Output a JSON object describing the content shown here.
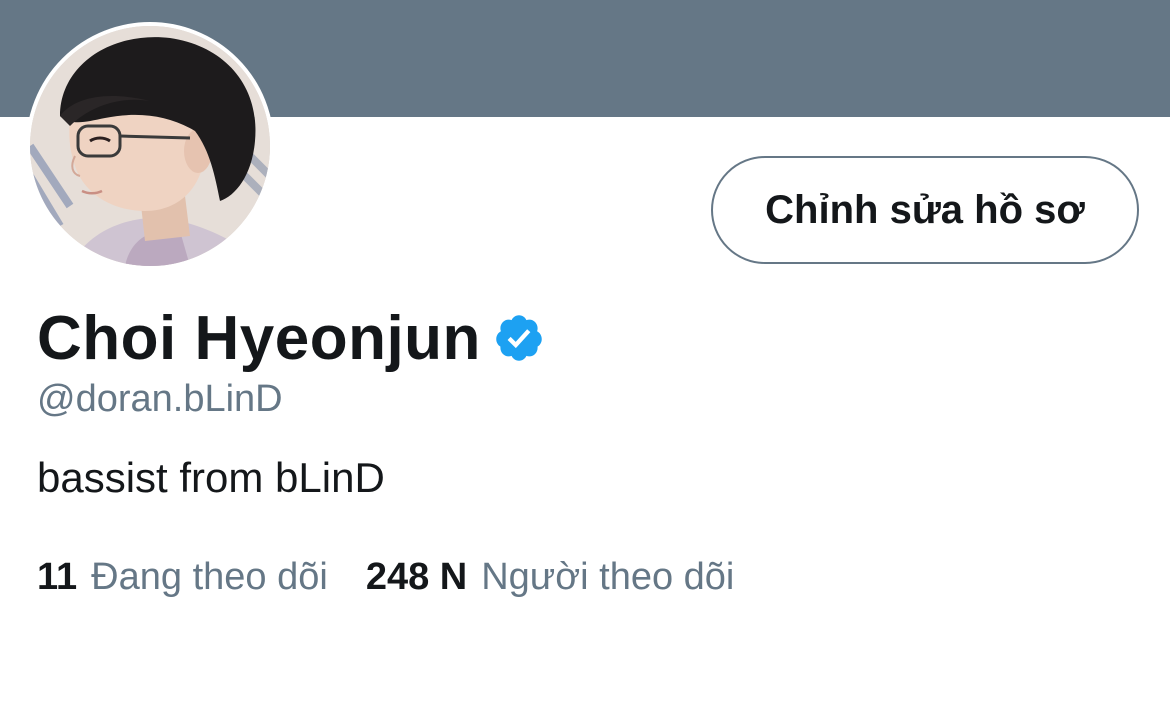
{
  "colors": {
    "banner": "#657786",
    "text_primary": "#14171a",
    "text_secondary": "#657786",
    "verified_blue": "#1da1f2"
  },
  "profile": {
    "avatar_icon": "profile-photo",
    "edit_button_label": "Chỉnh sửa hồ sơ",
    "display_name": "Choi Hyeonjun",
    "verified_icon": "verified-badge-icon",
    "handle": "@doran.bLinD",
    "bio": "bassist from bLinD"
  },
  "stats": {
    "following_count": "11",
    "following_label": "Đang theo dõi",
    "followers_count": "248 N",
    "followers_label": "Người theo dõi"
  }
}
